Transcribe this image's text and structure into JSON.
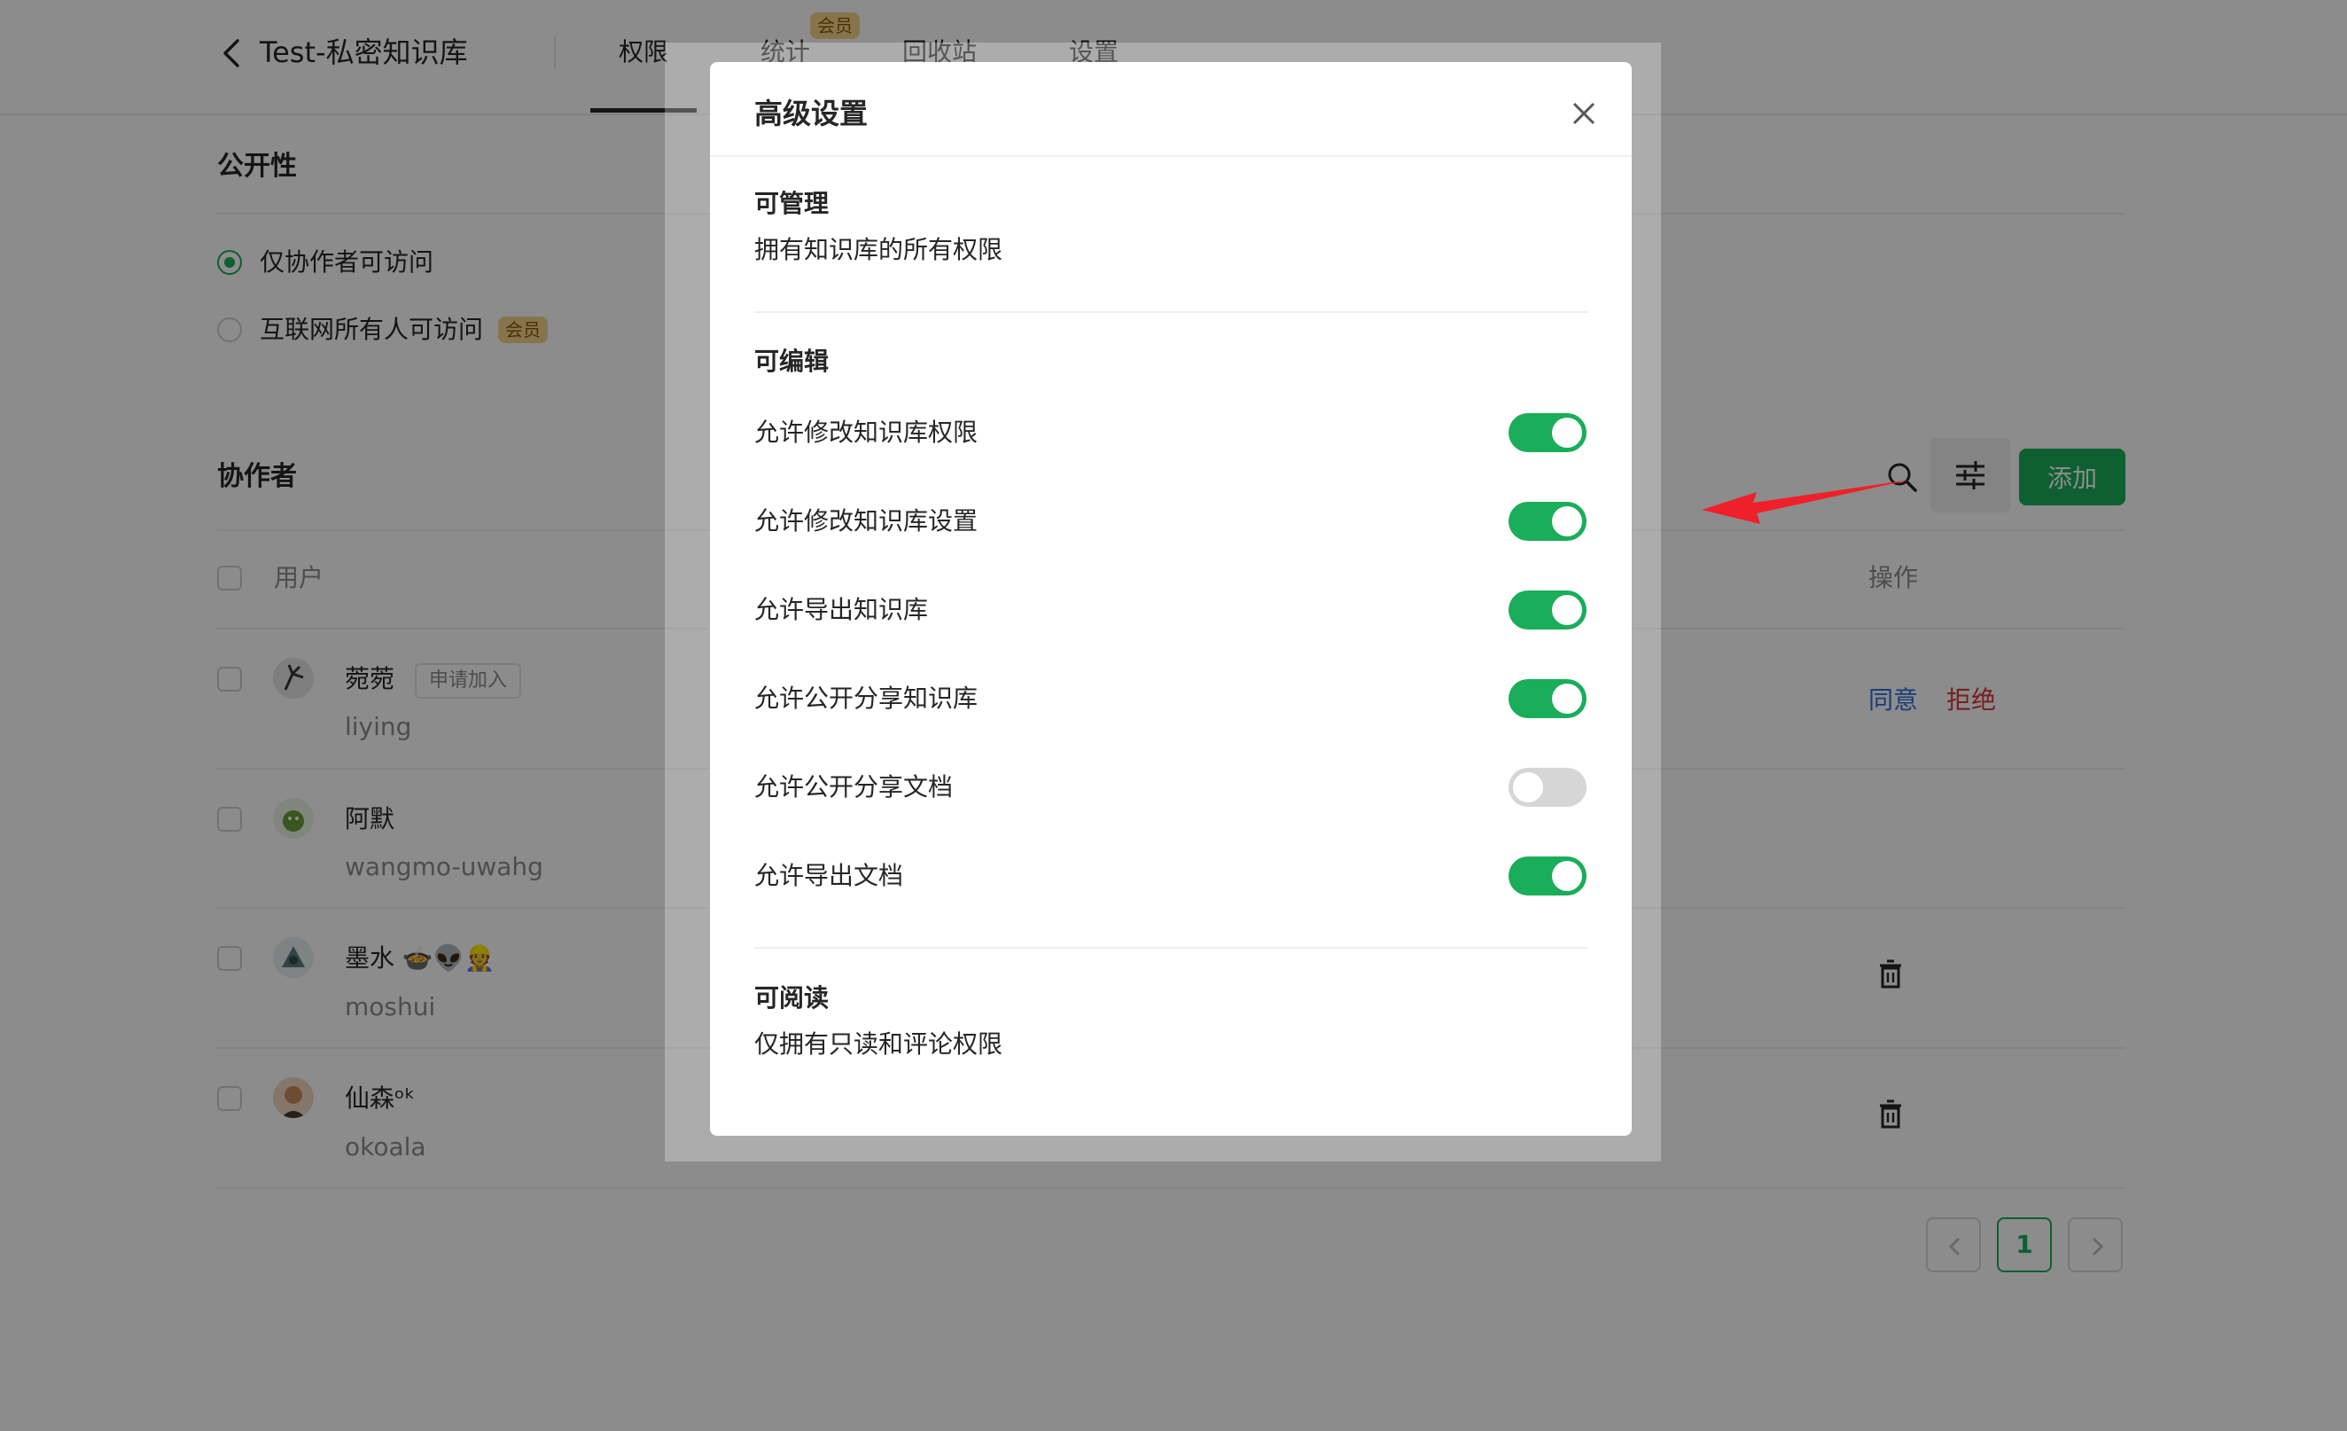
{
  "header": {
    "title": "Test-私密知识库",
    "tabs": [
      {
        "label": "权限",
        "active": true
      },
      {
        "label": "统计",
        "badge": "会员"
      },
      {
        "label": "回收站"
      },
      {
        "label": "设置"
      }
    ]
  },
  "publicity": {
    "title": "公开性",
    "options": [
      {
        "label": "仅协作者可访问",
        "selected": true
      },
      {
        "label": "互联网所有人可访问",
        "badge": "会员",
        "selected": false
      }
    ]
  },
  "collaborators": {
    "title": "协作者",
    "add_label": "添加",
    "columns": {
      "user": "用户",
      "action": "操作"
    },
    "users": [
      {
        "name": "菀菀",
        "login": "liying",
        "tag": "申请加入",
        "actions": [
          "同意",
          "拒绝"
        ]
      },
      {
        "name": "阿默",
        "login": "wangmo-uwahg"
      },
      {
        "name": "墨水 🍲👽👷",
        "login": "moshui"
      },
      {
        "name": "仙森ᵒᵏ",
        "login": "okoala"
      }
    ],
    "pagination": {
      "current": "1"
    }
  },
  "modal": {
    "title": "高级设置",
    "manage": {
      "heading": "可管理",
      "desc": "拥有知识库的所有权限"
    },
    "edit": {
      "heading": "可编辑",
      "permissions": [
        {
          "label": "允许修改知识库权限",
          "on": true
        },
        {
          "label": "允许修改知识库设置",
          "on": true
        },
        {
          "label": "允许导出知识库",
          "on": true
        },
        {
          "label": "允许公开分享知识库",
          "on": true
        },
        {
          "label": "允许公开分享文档",
          "on": false
        },
        {
          "label": "允许导出文档",
          "on": true
        }
      ]
    },
    "read": {
      "heading": "可阅读",
      "desc": "仅拥有只读和评论权限"
    }
  },
  "colors": {
    "accent_green": "#1aad5a",
    "link_blue": "#2f6fd8",
    "reject_red": "#d9363e",
    "vip_gold": "#f4d58a",
    "annotation_red": "#f0202a"
  },
  "icons": [
    "chevron-left-icon",
    "search-icon",
    "sliders-icon",
    "trash-icon",
    "close-icon",
    "arrow-annotation"
  ]
}
